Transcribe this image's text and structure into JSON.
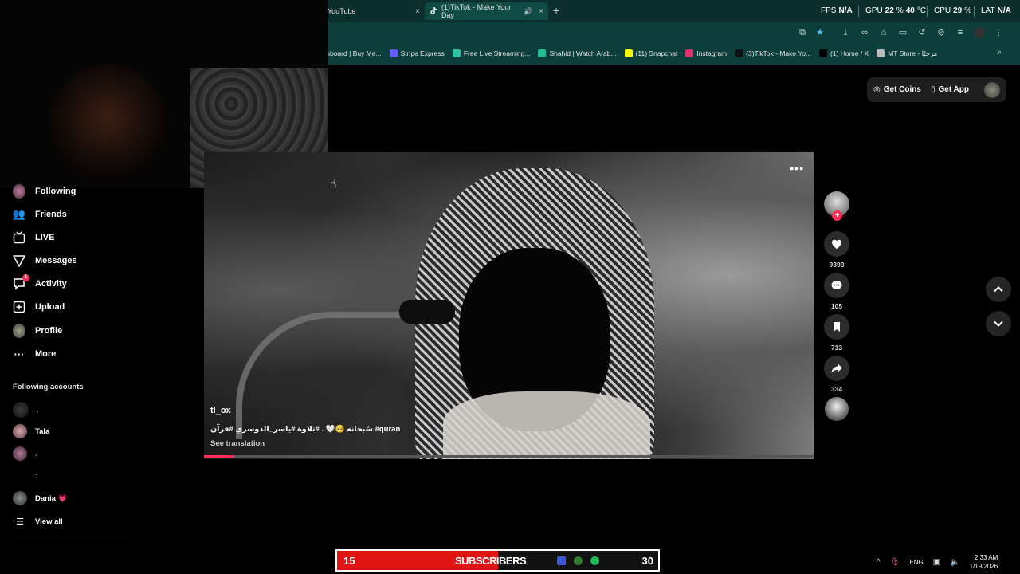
{
  "browser": {
    "tabs": [
      {
        "label": "YouTube",
        "active": false
      },
      {
        "label": "(1)TikTok - Make Your Day",
        "active": true
      }
    ],
    "new_tab": "+",
    "close_glyph": "×",
    "bookmarks": [
      {
        "label": "shboard | Buy Me...",
        "color": "#f0b400"
      },
      {
        "label": "Stripe Express",
        "color": "#635bff"
      },
      {
        "label": "Free Live Streaming...",
        "color": "#2bc4a6"
      },
      {
        "label": "Shahid | Watch Arab...",
        "color": "#1fbf8f"
      },
      {
        "label": "(11) Snapchat",
        "color": "#fffc00"
      },
      {
        "label": "Instagram",
        "color": "#e1306c"
      },
      {
        "label": "(3)TikTok - Make Yo...",
        "color": "#111111"
      },
      {
        "label": "(1) Home / X",
        "color": "#000000"
      },
      {
        "label": "MT Store - مرحبًا",
        "color": "#bbbbbb"
      }
    ],
    "bookmarks_more": "»"
  },
  "overlay_stats": {
    "fps_label": "FPS",
    "fps_value": "N/A",
    "gpu_label": "GPU",
    "gpu_value": "22",
    "gpu_unit": "%",
    "gpu_temp": "40",
    "gpu_temp_unit": "°C",
    "cpu_label": "CPU",
    "cpu_value": "29",
    "cpu_unit": "%",
    "lat_label": "LAT",
    "lat_value": "N/A"
  },
  "page_actions": {
    "coins": "Get Coins",
    "app": "Get App"
  },
  "sidebar": {
    "nav": [
      {
        "label": "Following",
        "icon": "avatar-icon"
      },
      {
        "label": "Friends",
        "icon": "friends-icon"
      },
      {
        "label": "LIVE",
        "icon": "live-icon"
      },
      {
        "label": "Messages",
        "icon": "messages-icon"
      },
      {
        "label": "Activity",
        "icon": "activity-icon",
        "badge": "1"
      },
      {
        "label": "Upload",
        "icon": "upload-icon"
      },
      {
        "label": "Profile",
        "icon": "profile-icon"
      },
      {
        "label": "More",
        "icon": "more-icon"
      }
    ],
    "following_title": "Following accounts",
    "accounts": [
      {
        "name": "."
      },
      {
        "name": "Tala"
      },
      {
        "name": "."
      },
      {
        "name": "."
      },
      {
        "name": "Dania 💗"
      }
    ],
    "view_all": "View all"
  },
  "video": {
    "author": "tl_ox",
    "caption": "سُبحانه 🥺🤍 . #تلاوة #ياسر_الدوسري #قرآن #quran",
    "see_translation": "See translation",
    "menu": "•••",
    "progress": 0.05
  },
  "actions": {
    "follow": "+",
    "likes": "9399",
    "comments": "105",
    "saves": "713",
    "shares": "334"
  },
  "subscribers": {
    "current": "15",
    "label": "SUBSCRIBERS",
    "goal": "30",
    "fill": 0.5,
    "fill_color": "#e11414"
  },
  "tray": {
    "lang": "ENG",
    "time": "2:33 AM",
    "date": "1/19/2026",
    "chevron": "^"
  }
}
